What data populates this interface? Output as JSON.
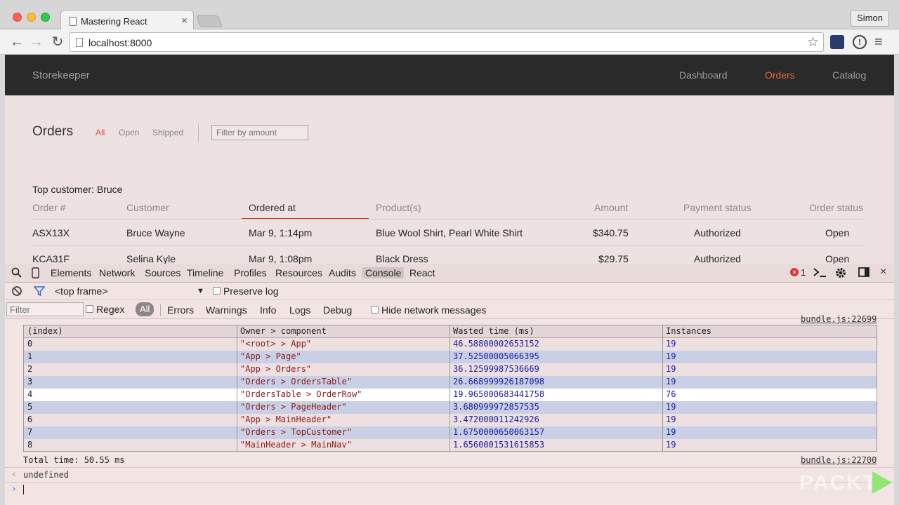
{
  "browser": {
    "tab_title": "Mastering React",
    "tab_close": "×",
    "profile": "Simon",
    "url": "localhost:8000",
    "back": "←",
    "forward": "→",
    "reload": "↻",
    "star": "☆",
    "info": "!",
    "menu": "≡"
  },
  "app": {
    "brand": "Storekeeper",
    "nav": [
      "Dashboard",
      "Orders",
      "Catalog"
    ],
    "active_nav": "Orders",
    "accent_color": "#e0683c"
  },
  "orders": {
    "title": "Orders",
    "filters": [
      "All",
      "Open",
      "Shipped"
    ],
    "active_filter": "All",
    "amount_placeholder": "Filter by amount",
    "top_customer": "Top customer: Bruce",
    "columns": [
      "Order #",
      "Customer",
      "Ordered at",
      "Product(s)",
      "Amount",
      "Payment status",
      "Order status"
    ],
    "sorted_column": "Ordered at",
    "rows": [
      {
        "order": "ASX13X",
        "customer": "Bruce Wayne",
        "ordered_at": "Mar 9, 1:14pm",
        "products": "Blue Wool Shirt, Pearl White Shirt",
        "amount": "$340.75",
        "payment": "Authorized",
        "status": "Open"
      },
      {
        "order": "KCA31F",
        "customer": "Selina Kyle",
        "ordered_at": "Mar 9, 1:08pm",
        "products": "Black Dress",
        "amount": "$29.75",
        "payment": "Authorized",
        "status": "Open"
      }
    ]
  },
  "devtools": {
    "tabs": [
      "Elements",
      "Network",
      "Sources",
      "Timeline",
      "Profiles",
      "Resources",
      "Audits",
      "Console",
      "React"
    ],
    "active_tab": "Console",
    "error_count": "1",
    "error_glyph": "×",
    "close_glyph": "×",
    "frame": "<top frame>",
    "frame_arrow": "▼",
    "preserve_log": "Preserve log",
    "filter_placeholder": "Filter",
    "regex": "Regex",
    "levels": [
      "All",
      "Errors",
      "Warnings",
      "Info",
      "Logs",
      "Debug"
    ],
    "active_level": "All",
    "hide_network": "Hide network messages"
  },
  "console": {
    "source_top": "bundle.js:22699",
    "table_headers": [
      "(index)",
      "Owner > component",
      "Wasted time (ms)",
      "Instances"
    ],
    "table_rows": [
      [
        "0",
        "\"<root> > App\"",
        "46.58800002653152",
        "19"
      ],
      [
        "1",
        "\"App > Page\"",
        "37.52500005066395",
        "19"
      ],
      [
        "2",
        "\"App > Orders\"",
        "36.12599987536669",
        "19"
      ],
      [
        "3",
        "\"Orders > OrdersTable\"",
        "26.668999926187098",
        "19"
      ],
      [
        "4",
        "\"OrdersTable > OrderRow\"",
        "19.965000683441758",
        "76"
      ],
      [
        "5",
        "\"Orders > PageHeader\"",
        "3.680999972857535",
        "19"
      ],
      [
        "6",
        "\"App > MainHeader\"",
        "3.472000011242926",
        "19"
      ],
      [
        "7",
        "\"Orders > TopCustomer\"",
        "1.6750000650063157",
        "19"
      ],
      [
        "8",
        "\"MainHeader > MainNav\"",
        "1.6560001531615853",
        "19"
      ]
    ],
    "selected_row": 4,
    "total": "Total time: 50.55 ms",
    "source_bottom": "bundle.js:22700",
    "result": "undefined",
    "result_glyph": "‹",
    "prompt_glyph": "›"
  },
  "watermark": "PACKT"
}
